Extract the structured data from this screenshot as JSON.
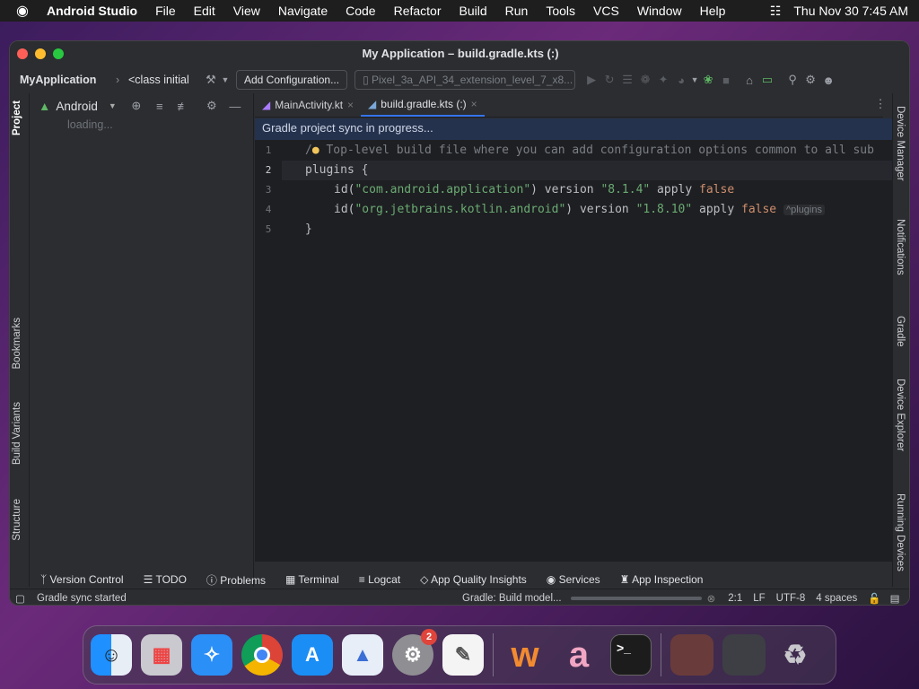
{
  "menubar": {
    "apple": "",
    "app": "Android Studio",
    "items": [
      "File",
      "Edit",
      "View",
      "Navigate",
      "Code",
      "Refactor",
      "Build",
      "Run",
      "Tools",
      "VCS",
      "Window",
      "Help"
    ],
    "datetime": "Thu Nov 30  7:45 AM"
  },
  "window": {
    "title": "My Application – build.gradle.kts (:)"
  },
  "toolbar": {
    "project": "MyApplication",
    "class_crumb": "<class initial",
    "config": "Add Configuration...",
    "device": "Pixel_3a_API_34_extension_level_7_x8..."
  },
  "left_strip": {
    "project": "Project",
    "bookmarks": "Bookmarks",
    "build_variants": "Build Variants",
    "structure": "Structure"
  },
  "project_panel": {
    "view": "Android",
    "loading": "loading..."
  },
  "tabs": [
    {
      "label": "MainActivity.kt"
    },
    {
      "label": "build.gradle.kts (:)"
    }
  ],
  "banner": "Gradle project sync in progress...",
  "code": {
    "line1": "Top-level build file where you can add configuration options common to all sub",
    "plugins": "plugins {",
    "id": "id(",
    "s1": "\"com.android.application\"",
    "v1": "\"8.1.4\"",
    "s2": "\"org.jetbrains.kotlin.android\"",
    "v2": "\"1.8.10\"",
    "version": ") version ",
    "apply": " apply ",
    "false": "false",
    "hint": "^plugins",
    "close": "}"
  },
  "line_numbers": [
    "1",
    "2",
    "3",
    "4",
    "5"
  ],
  "right_strip": {
    "device_manager": "Device Manager",
    "notifications": "Notifications",
    "gradle": "Gradle",
    "device_explorer": "Device Explorer",
    "running_devices": "Running Devices"
  },
  "bottom_tabs": [
    "Version Control",
    "TODO",
    "Problems",
    "Terminal",
    "Logcat",
    "App Quality Insights",
    "Services",
    "App Inspection"
  ],
  "status": {
    "left": "Gradle sync started",
    "progress": "Gradle: Build model...",
    "position": "2:1",
    "le": "LF",
    "enc": "UTF-8",
    "indent": "4 spaces"
  },
  "dock": {
    "settings_badge": "2"
  }
}
